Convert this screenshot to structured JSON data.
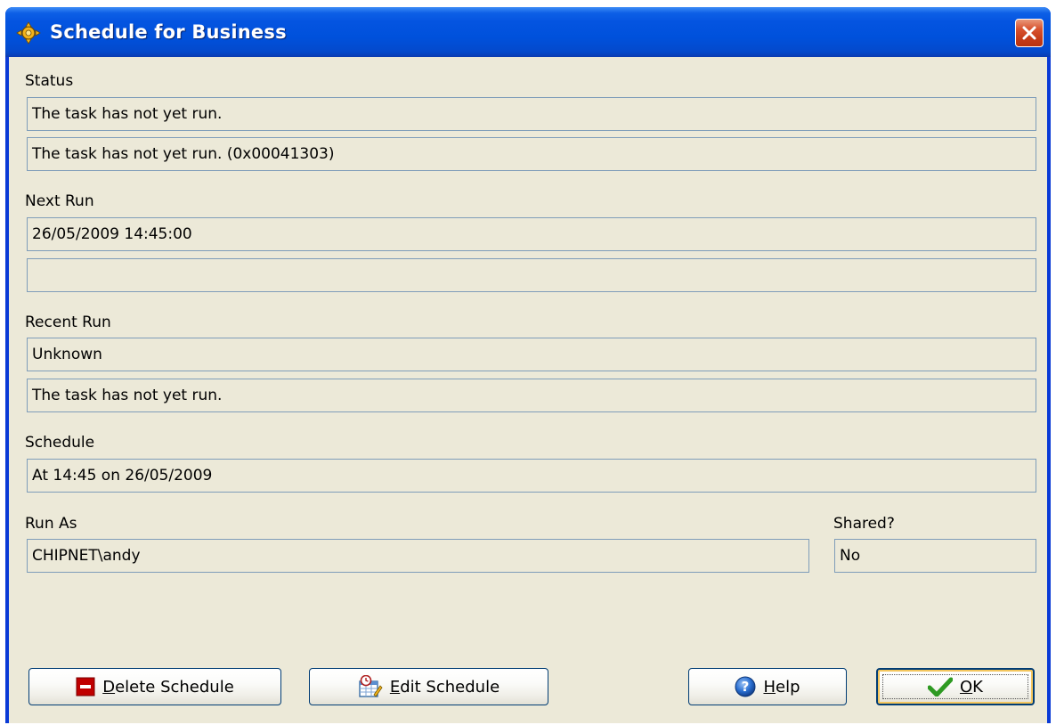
{
  "window": {
    "title": "Schedule for Business"
  },
  "status": {
    "label": "Status",
    "line1": "The task has not yet run.",
    "line2": "The task has not yet run. (0x00041303)"
  },
  "next_run": {
    "label": "Next Run",
    "line1": "26/05/2009 14:45:00",
    "line2": ""
  },
  "recent_run": {
    "label": "Recent Run",
    "line1": "Unknown",
    "line2": "The task has not yet run."
  },
  "schedule": {
    "label": "Schedule",
    "value": "At 14:45 on 26/05/2009"
  },
  "run_as": {
    "label": "Run As",
    "value": "CHIPNET\\andy"
  },
  "shared": {
    "label": "Shared?",
    "value": "No"
  },
  "buttons": {
    "delete_schedule": {
      "label_prefix": "",
      "mnemonic": "D",
      "label_rest": "elete Schedule",
      "icon": "delete-icon"
    },
    "edit_schedule": {
      "label_prefix": "",
      "mnemonic": "E",
      "label_rest": "dit Schedule",
      "icon": "schedule-edit-icon"
    },
    "help": {
      "label_prefix": "",
      "mnemonic": "H",
      "label_rest": "elp",
      "icon": "help-icon"
    },
    "ok": {
      "label_prefix": "",
      "mnemonic": "O",
      "label_rest": "K",
      "icon": "checkmark-icon"
    }
  },
  "colors": {
    "titlebar": "#0454e0",
    "client_background": "#ece9d8",
    "field_border": "#7f9db9",
    "close_button": "#c63c18",
    "delete_icon": "#c00000",
    "ok_check": "#2e9a22",
    "help_icon": "#2a6fd1"
  }
}
